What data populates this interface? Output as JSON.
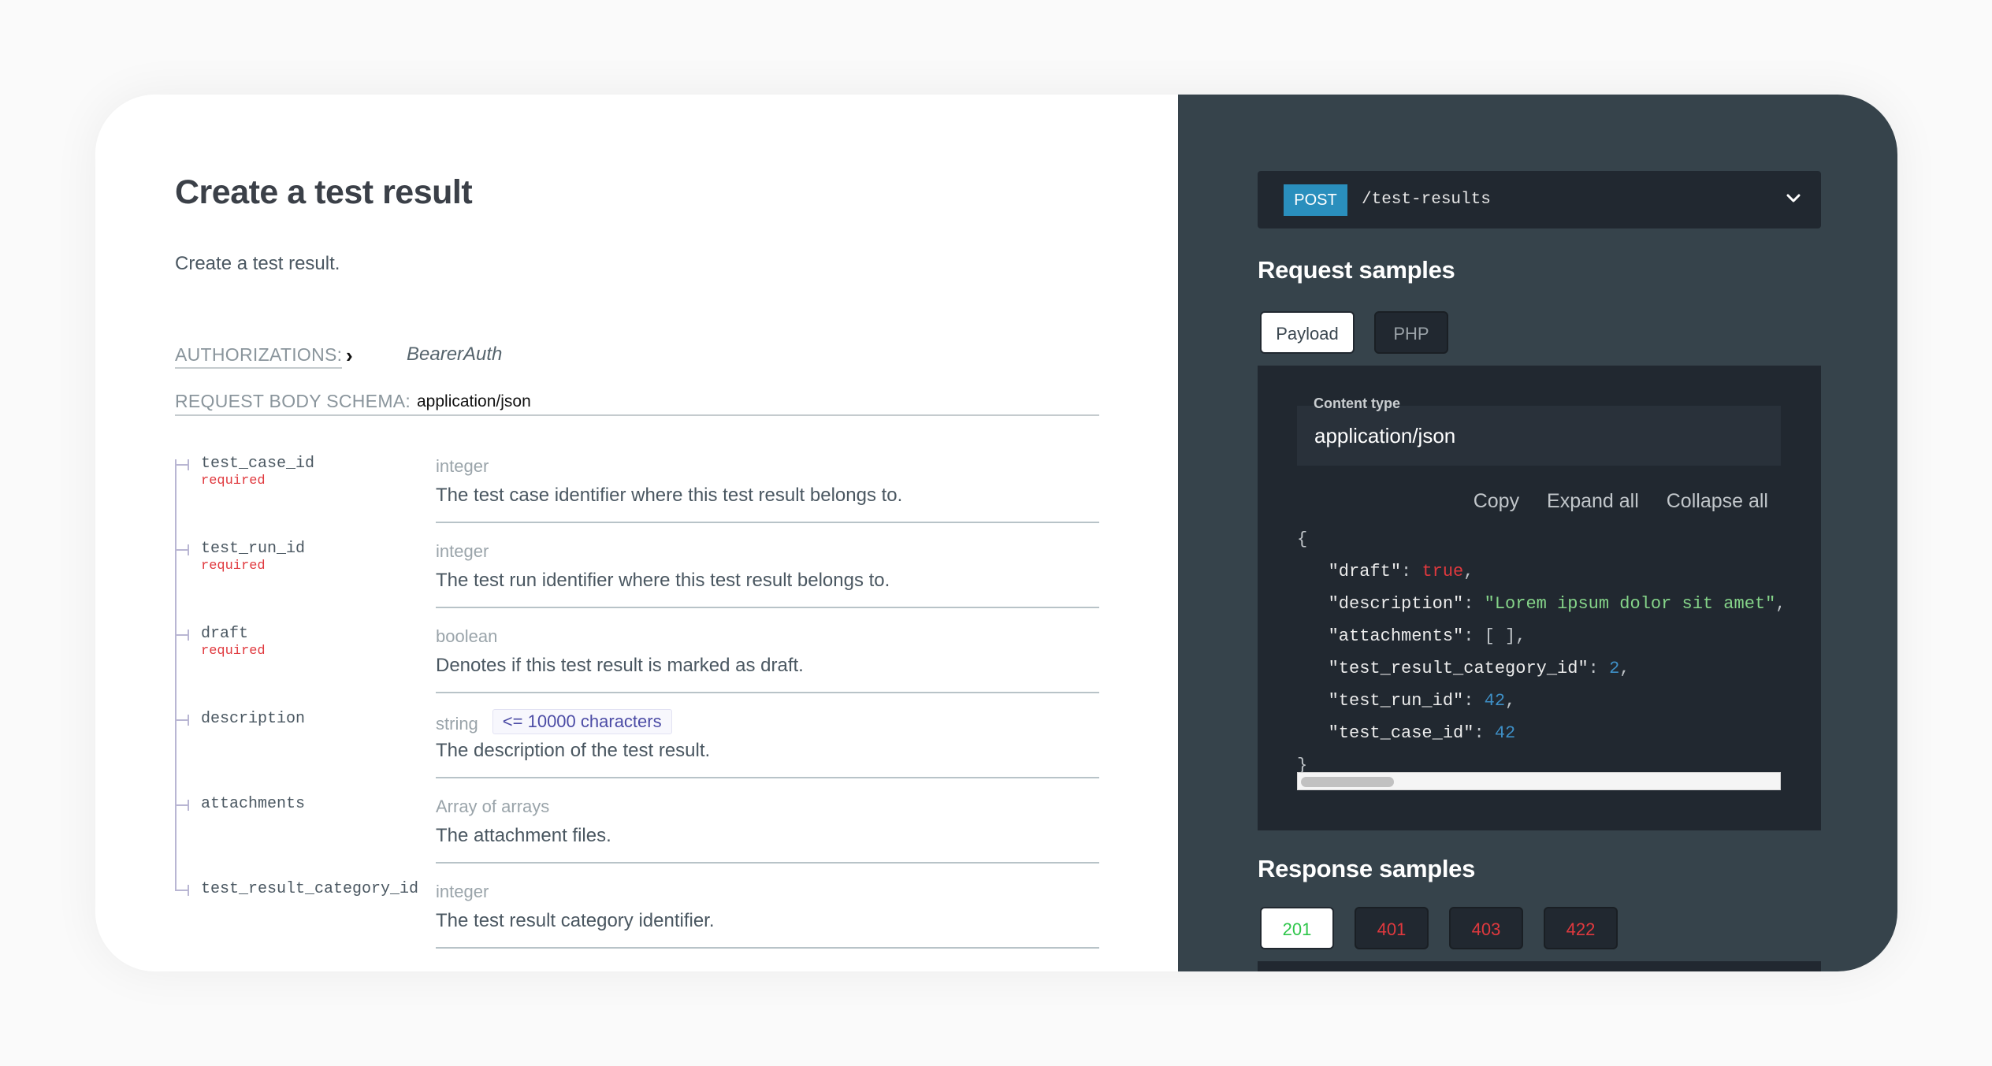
{
  "header": {
    "title": "Create a test result",
    "subtitle": "Create a test result."
  },
  "authorizations": {
    "label": "AUTHORIZATIONS:",
    "value": "BearerAuth"
  },
  "request_body": {
    "label": "REQUEST BODY SCHEMA:",
    "value": "application/json"
  },
  "fields": [
    {
      "name": "test_case_id",
      "required": "required",
      "type": "integer",
      "constraint": "",
      "description": "The test case identifier where this test result belongs to."
    },
    {
      "name": "test_run_id",
      "required": "required",
      "type": "integer",
      "constraint": "",
      "description": "The test run identifier where this test result belongs to."
    },
    {
      "name": "draft",
      "required": "required",
      "type": "boolean",
      "constraint": "",
      "description": "Denotes if this test result is marked as draft."
    },
    {
      "name": "description",
      "required": "",
      "type": "string",
      "constraint": "<= 10000 characters",
      "description": "The description of the test result."
    },
    {
      "name": "attachments",
      "required": "",
      "type": "Array of arrays",
      "constraint": "",
      "description": "The attachment files."
    },
    {
      "name": "test_result_category_id",
      "required": "",
      "type": "integer",
      "constraint": "",
      "description": "The test result category identifier."
    }
  ],
  "endpoint": {
    "method": "POST",
    "path": "/test-results",
    "method_color": "#2a8fbd"
  },
  "request_samples": {
    "title": "Request samples",
    "tabs": [
      {
        "label": "Payload",
        "active": true
      },
      {
        "label": "PHP",
        "active": false
      }
    ],
    "content_type_label": "Content type",
    "content_type_value": "application/json",
    "actions": [
      "Copy",
      "Expand all",
      "Collapse all"
    ],
    "code": {
      "open": "{",
      "close": "}",
      "lines": [
        {
          "key": "\"draft\"",
          "value": "true",
          "kind": "bool",
          "comma": ","
        },
        {
          "key": "\"description\"",
          "value": "\"Lorem ipsum dolor sit amet\"",
          "kind": "str",
          "comma": ","
        },
        {
          "key": "\"attachments\"",
          "value": "[ ]",
          "kind": "punct",
          "comma": ","
        },
        {
          "key": "\"test_result_category_id\"",
          "value": "2",
          "kind": "num",
          "comma": ","
        },
        {
          "key": "\"test_run_id\"",
          "value": "42",
          "kind": "num",
          "comma": ","
        },
        {
          "key": "\"test_case_id\"",
          "value": "42",
          "kind": "num",
          "comma": ""
        }
      ]
    }
  },
  "response_samples": {
    "title": "Response samples",
    "tabs": [
      {
        "label": "201",
        "active": true,
        "color": "#2ec64a"
      },
      {
        "label": "401",
        "active": false,
        "color": "#e0393e"
      },
      {
        "label": "403",
        "active": false,
        "color": "#e0393e"
      },
      {
        "label": "422",
        "active": false,
        "color": "#e0393e"
      }
    ]
  }
}
